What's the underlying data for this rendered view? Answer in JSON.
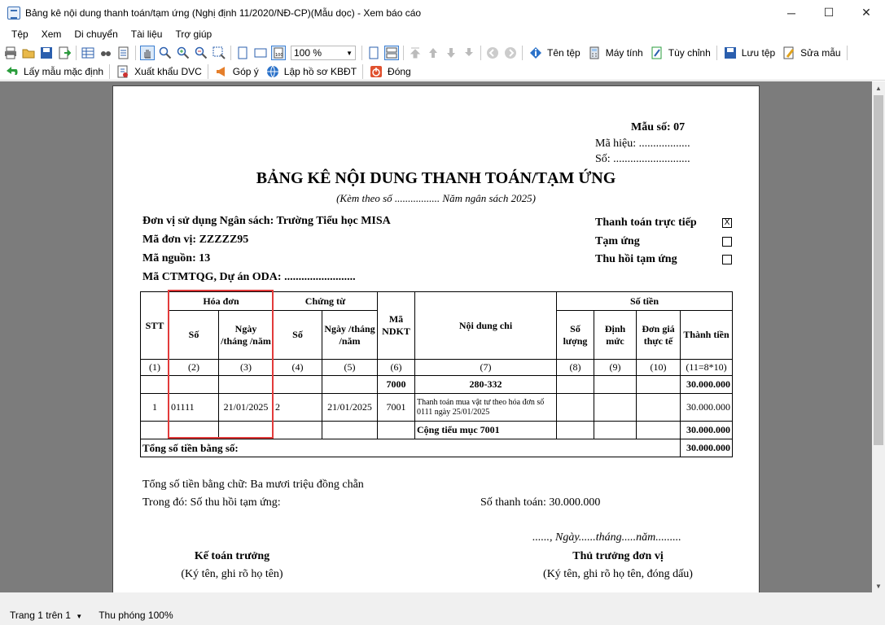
{
  "window": {
    "title": "Bảng kê nội dung thanh toán/tạm ứng (Nghị định 11/2020/NĐ-CP)(Mẫu dọc) - Xem báo cáo",
    "min_label": "─",
    "max_label": "☐",
    "close_label": "✕"
  },
  "menu": [
    "Tệp",
    "Xem",
    "Di chuyển",
    "Tài liệu",
    "Trợ giúp"
  ],
  "toolbar": {
    "zoom_value": "100 %",
    "file_name": "Tên tệp",
    "calculator": "Máy tính",
    "customize": "Tùy chỉnh",
    "save_file": "Lưu tệp",
    "edit_template": "Sửa mẫu",
    "default_template": "Lấy mẫu mặc định",
    "export_dvc": "Xuất khẩu DVC",
    "feedback": "Góp ý",
    "kbdt": "Lập hồ sơ KBĐT",
    "close": "Đóng"
  },
  "report": {
    "form_number": "Mẫu số: 07",
    "symbol": "Mã hiệu: ..................",
    "number": "Số: ...........................",
    "title": "BẢNG KÊ NỘI DUNG THANH TOÁN/TẠM ỨNG",
    "subtitle": "(Kèm theo  số ................. Năm ngân sách 2025)",
    "unit_label": "Đơn vị sử dụng Ngân sách:",
    "unit_value": "Trường Tiểu học MISA",
    "unit_code_label": "Mã đơn vị:",
    "unit_code_value": "ZZZZZ95",
    "source_label": "Mã nguồn:",
    "source_value": "13",
    "ctmtqg_label": "Mã CTMTQG, Dự án ODA: .........................",
    "opt_direct": "Thanh toán trực tiếp",
    "opt_direct_mark": "X",
    "opt_advance": "Tạm ứng",
    "opt_recover": "Thu hồi tạm ứng",
    "headers": {
      "stt": "STT",
      "invoice": "Hóa đơn",
      "voucher": "Chứng từ",
      "ndkt": "Mã NDKT",
      "content": "Nội dung chi",
      "amount": "Số tiền",
      "so": "Số",
      "ngay": "Ngày /tháng /năm",
      "qty": "Số lượng",
      "norm": "Định mức",
      "unit_price": "Đơn giá thực tế",
      "total": "Thành tiền"
    },
    "col_index": [
      "(1)",
      "(2)",
      "(3)",
      "(4)",
      "(5)",
      "(6)",
      "(7)",
      "(8)",
      "(9)",
      "(10)",
      "(11=8*10)"
    ],
    "group_row": {
      "ndkt": "7000",
      "content": "280-332",
      "total": "30.000.000"
    },
    "data_row": {
      "stt": "1",
      "invoice_no": "01111",
      "invoice_date": "21/01/2025",
      "voucher_no": "2",
      "voucher_date": "21/01/2025",
      "ndkt": "7001",
      "content": "Thanh toán mua vật tư theo hóa đơn số 0111 ngày 25/01/2025",
      "total": "30.000.000"
    },
    "subtotal_row": {
      "label": "Cộng tiểu mục 7001",
      "total": "30.000.000"
    },
    "grand_total_label": "Tổng số tiền bằng số:",
    "grand_total_value": "30.000.000",
    "words": "Tổng số tiền bằng chữ: Ba mươi triệu đồng chẵn",
    "recover_label": "Trong đó:  Số thu hồi tạm ứng:",
    "payment_label": "Số thanh toán: 30.000.000",
    "date_line": "......, Ngày......tháng.....năm.........",
    "chief_accountant": "Kế toán trưởng",
    "chief_accountant_sign": "(Ký tên, ghi rõ họ tên)",
    "head_of_unit": "Thủ trưởng đơn vị",
    "head_of_unit_sign": "(Ký tên, ghi rõ họ tên, đóng dấu)"
  },
  "status": {
    "page": "Trang 1 trên 1",
    "zoom": "Thu phóng 100%"
  }
}
